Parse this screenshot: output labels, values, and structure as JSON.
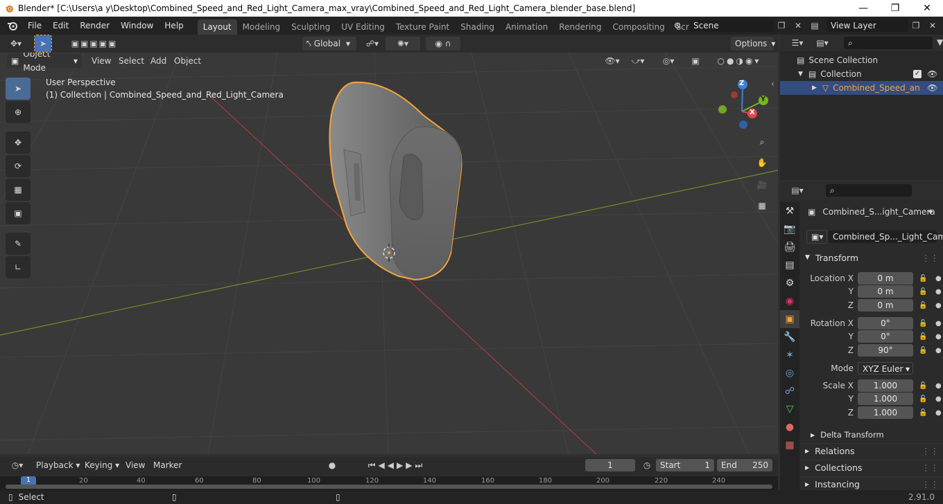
{
  "window": {
    "title": "Blender* [C:\\Users\\a y\\Desktop\\Combined_Speed_and_Red_Light_Camera_max_vray\\Combined_Speed_and_Red_Light_Camera_blender_base.blend]",
    "minimize": "—",
    "maximize": "❐",
    "close": "✕"
  },
  "menubar": {
    "items": [
      "File",
      "Edit",
      "Render",
      "Window",
      "Help"
    ]
  },
  "workspaces": {
    "tabs": [
      "Layout",
      "Modeling",
      "Sculpting",
      "UV Editing",
      "Texture Paint",
      "Shading",
      "Animation",
      "Rendering",
      "Compositing",
      "Scripting"
    ],
    "active": "Layout",
    "add": "+"
  },
  "scene": {
    "name": "Scene",
    "view_layer": "View Layer"
  },
  "viewport_header": {
    "transform_orientation": "Global",
    "options": "Options"
  },
  "viewport_subheader": {
    "mode": "Object Mode",
    "menus": [
      "View",
      "Select",
      "Add",
      "Object"
    ]
  },
  "viewport": {
    "perspective": "User Perspective",
    "collection_info": "(1) Collection | Combined_Speed_and_Red_Light_Camera"
  },
  "gizmo": {
    "z": "Z",
    "y": "Y",
    "x": "X"
  },
  "outliner": {
    "search_placeholder": "",
    "rows": [
      "Scene Collection",
      "Collection",
      "Combined_Speed_an"
    ]
  },
  "properties": {
    "object_name": "Combined_S...ight_Camera",
    "data_name": "Combined_Sp..._Light_Camera",
    "transform_title": "Transform",
    "location": {
      "label_x": "Location X",
      "label_y": "Y",
      "label_z": "Z",
      "x": "0 m",
      "y": "0 m",
      "z": "0 m"
    },
    "rotation": {
      "label_x": "Rotation X",
      "label_y": "Y",
      "label_z": "Z",
      "x": "0°",
      "y": "0°",
      "z": "90°"
    },
    "mode": {
      "label": "Mode",
      "value": "XYZ Euler"
    },
    "scale": {
      "label_x": "Scale X",
      "label_y": "Y",
      "label_z": "Z",
      "x": "1.000",
      "y": "1.000",
      "z": "1.000"
    },
    "sections": [
      "Delta Transform",
      "Relations",
      "Collections",
      "Instancing"
    ]
  },
  "timeline": {
    "menus": [
      "Playback",
      "Keying",
      "View",
      "Marker"
    ],
    "current_frame": "1",
    "start_label": "Start",
    "start": "1",
    "end_label": "End",
    "end": "250",
    "ruler": [
      "1",
      "20",
      "40",
      "60",
      "80",
      "100",
      "120",
      "140",
      "160",
      "180",
      "200",
      "220",
      "240"
    ]
  },
  "statusbar": {
    "select": "Select",
    "version": "2.91.0"
  },
  "colors": {
    "accent": "#4772b3",
    "selection": "#f5a33c",
    "x_axis": "#e0464e",
    "y_axis": "#78b420",
    "z_axis": "#3f7fd6"
  }
}
